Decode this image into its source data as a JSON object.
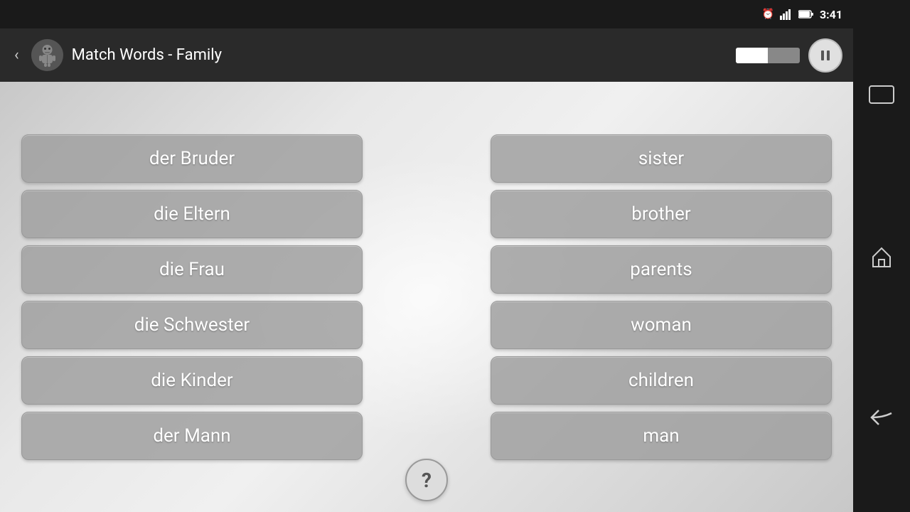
{
  "statusBar": {
    "time": "3:41",
    "icons": [
      "alarm",
      "signal",
      "battery"
    ]
  },
  "topBar": {
    "backLabel": "‹",
    "title": "Match Words - Family",
    "progressPercent": 50,
    "pauseLabel": "⏸"
  },
  "germanWords": [
    {
      "id": "w1",
      "text": "der Bruder"
    },
    {
      "id": "w2",
      "text": "die Eltern"
    },
    {
      "id": "w3",
      "text": "die Frau"
    },
    {
      "id": "w4",
      "text": "die Schwester"
    },
    {
      "id": "w5",
      "text": "die Kinder"
    },
    {
      "id": "w6",
      "text": "der Mann"
    }
  ],
  "englishWords": [
    {
      "id": "e1",
      "text": "sister"
    },
    {
      "id": "e2",
      "text": "brother"
    },
    {
      "id": "e3",
      "text": "parents"
    },
    {
      "id": "e4",
      "text": "woman"
    },
    {
      "id": "e5",
      "text": "children"
    },
    {
      "id": "e6",
      "text": "man"
    }
  ],
  "helpLabel": "?",
  "sideNav": {
    "landscapeIcon": "⬜",
    "homeIcon": "⌂",
    "backIcon": "←"
  }
}
